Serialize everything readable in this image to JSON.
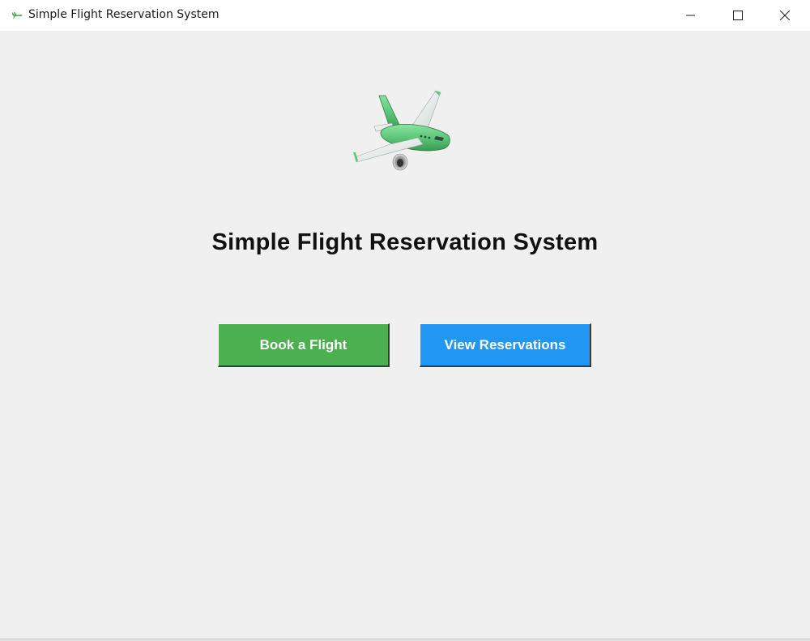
{
  "window": {
    "title": "Simple Flight Reservation System",
    "icon": "airplane-icon",
    "controls": [
      "minimize-icon",
      "maximize-icon",
      "close-icon"
    ]
  },
  "main": {
    "logo_icon": "airplane-icon",
    "heading": "Simple Flight Reservation System",
    "buttons": {
      "book": "Book a Flight",
      "view": "View Reservations"
    }
  },
  "colors": {
    "background": "#f0f0f0",
    "book_button": "#4caf50",
    "view_button": "#2196f3",
    "button_text": "#ffffff",
    "plane_body": "#5cc878"
  }
}
